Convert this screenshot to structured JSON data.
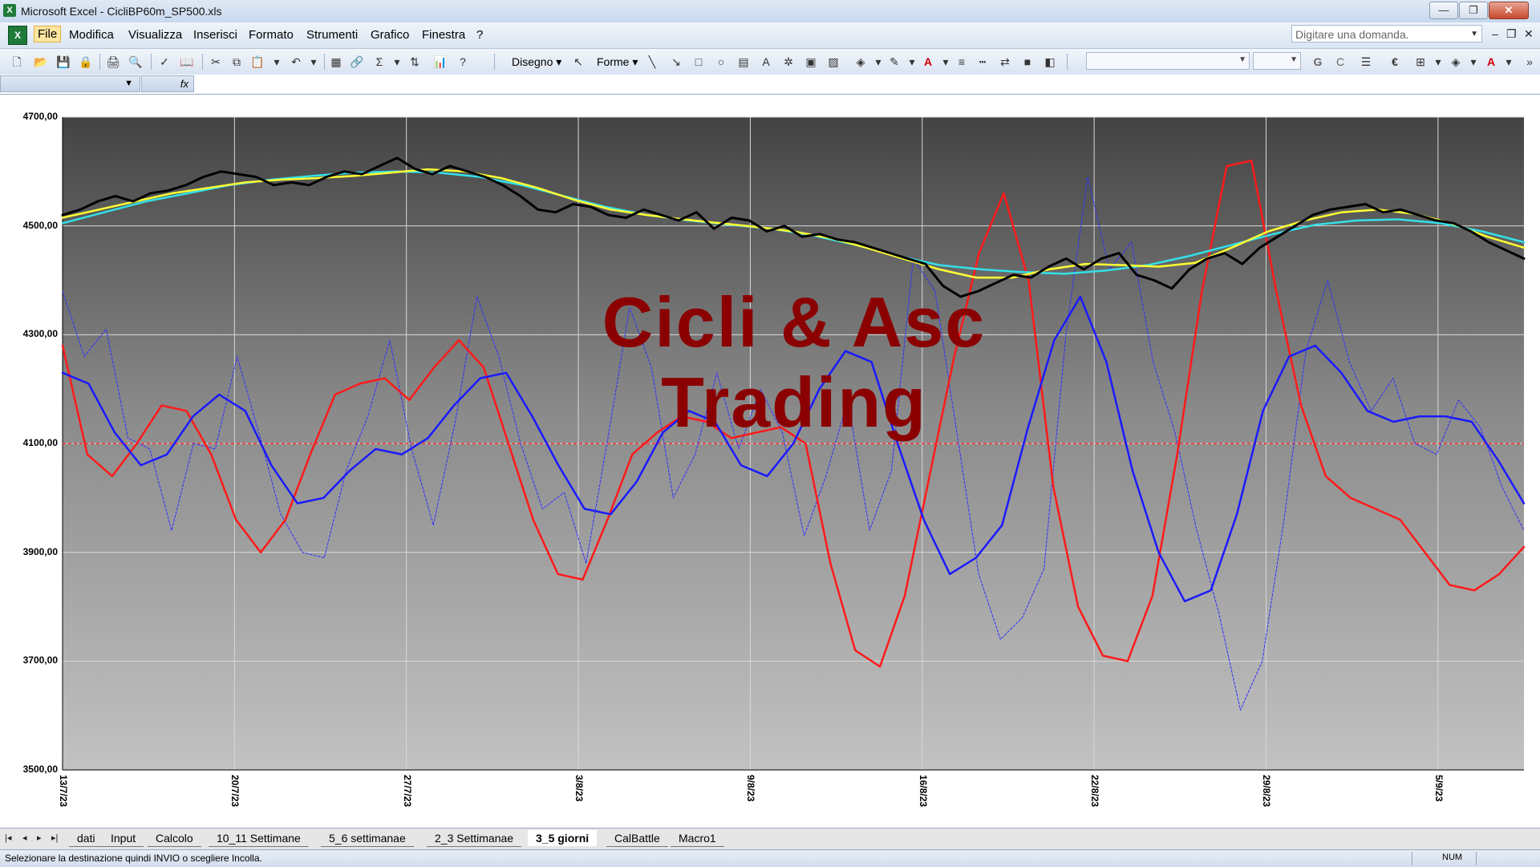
{
  "window": {
    "title": "Microsoft Excel - CicliBP60m_SP500.xls",
    "minimize": "—",
    "maximize": "❐",
    "close": "✕"
  },
  "menubar": {
    "items": [
      "File",
      "Modifica",
      "Visualizza",
      "Inserisci",
      "Formato",
      "Strumenti",
      "Grafico",
      "Finestra",
      "?"
    ],
    "active": "File",
    "ask_placeholder": "Digitare una domanda.",
    "mdi_min": "–",
    "mdi_restore": "❐",
    "mdi_close": "✕"
  },
  "toolbar": {
    "disegno_label": "Disegno ▾",
    "forme_label": "Forme ▾",
    "bold_label": "G",
    "italic_label": "C",
    "euro_label": "€"
  },
  "formula_bar": {
    "fx_label": "fx"
  },
  "chart_data": {
    "type": "line",
    "ylim": [
      3500,
      4700
    ],
    "yticks": [
      "4700,00",
      "4500,00",
      "4300,00",
      "4100,00",
      "3900,00",
      "3700,00",
      "3500,00"
    ],
    "xticks": [
      "13/7/23",
      "20/7/23",
      "27/7/23",
      "3/8/23",
      "9/8/23",
      "16/8/23",
      "22/8/23",
      "29/8/23",
      "5/9/23"
    ],
    "reference_line": 4100,
    "watermark": [
      "Cicli & Asc",
      "Trading"
    ],
    "colors": {
      "price": "#000000",
      "avg_yellow": "#ffff33",
      "avg_cyan": "#33e0e8",
      "cycle_red": "#ff1a1a",
      "cycle_blue": "#1a1aff",
      "cycle_blue_dotted": "#3030ff",
      "reference": "#ff3333"
    },
    "series": [
      {
        "key": "price",
        "values": [
          4520,
          4530,
          4545,
          4555,
          4545,
          4560,
          4565,
          4575,
          4590,
          4600,
          4595,
          4590,
          4575,
          4580,
          4575,
          4590,
          4600,
          4595,
          4610,
          4625,
          4605,
          4595,
          4610,
          4600,
          4590,
          4575,
          4555,
          4530,
          4525,
          4540,
          4535,
          4520,
          4515,
          4530,
          4520,
          4510,
          4525,
          4495,
          4515,
          4510,
          4490,
          4500,
          4480,
          4485,
          4475,
          4470,
          4460,
          4450,
          4440,
          4430,
          4390,
          4370,
          4380,
          4395,
          4410,
          4405,
          4425,
          4440,
          4420,
          4440,
          4450,
          4410,
          4400,
          4385,
          4420,
          4440,
          4450,
          4430,
          4460,
          4480,
          4500,
          4520,
          4530,
          4535,
          4540,
          4525,
          4530,
          4520,
          4510,
          4505,
          4490,
          4470,
          4455,
          4440
        ]
      },
      {
        "key": "avg_yellow",
        "values": [
          4515,
          4530,
          4545,
          4560,
          4570,
          4580,
          4585,
          4588,
          4592,
          4598,
          4604,
          4600,
          4588,
          4570,
          4548,
          4530,
          4520,
          4512,
          4505,
          4498,
          4490,
          4478,
          4460,
          4440,
          4420,
          4405,
          4405,
          4420,
          4430,
          4428,
          4425,
          4432,
          4460,
          4490,
          4510,
          4525,
          4530,
          4522,
          4505,
          4480,
          4460
        ]
      },
      {
        "key": "avg_cyan",
        "values": [
          4505,
          4525,
          4545,
          4560,
          4575,
          4585,
          4592,
          4598,
          4600,
          4598,
          4590,
          4575,
          4555,
          4535,
          4520,
          4510,
          4502,
          4495,
          4482,
          4465,
          4445,
          4428,
          4420,
          4415,
          4412,
          4418,
          4428,
          4445,
          4465,
          4485,
          4502,
          4510,
          4512,
          4505,
          4490,
          4470
        ]
      },
      {
        "key": "cycle_red",
        "values": [
          4280,
          4080,
          4040,
          4100,
          4170,
          4160,
          4080,
          3960,
          3900,
          3960,
          4080,
          4190,
          4210,
          4220,
          4180,
          4240,
          4290,
          4240,
          4100,
          3960,
          3860,
          3850,
          3960,
          4080,
          4120,
          4150,
          4140,
          4110,
          4120,
          4130,
          4100,
          3880,
          3720,
          3690,
          3820,
          4040,
          4260,
          4450,
          4560,
          4400,
          4020,
          3800,
          3710,
          3700,
          3820,
          4080,
          4380,
          4610,
          4620,
          4380,
          4170,
          4040,
          4000,
          3980,
          3960,
          3900,
          3840,
          3830,
          3860,
          3910
        ]
      },
      {
        "key": "cycle_blue",
        "values": [
          4230,
          4210,
          4120,
          4060,
          4080,
          4150,
          4190,
          4160,
          4060,
          3990,
          4000,
          4050,
          4090,
          4080,
          4110,
          4170,
          4220,
          4230,
          4150,
          4060,
          3980,
          3970,
          4030,
          4120,
          4160,
          4140,
          4060,
          4040,
          4100,
          4200,
          4270,
          4250,
          4100,
          3960,
          3860,
          3890,
          3950,
          4130,
          4290,
          4370,
          4250,
          4050,
          3900,
          3810,
          3830,
          3970,
          4160,
          4260,
          4280,
          4230,
          4160,
          4140,
          4150,
          4150,
          4140,
          4070,
          3990
        ]
      },
      {
        "key": "cycle_blue_dotted",
        "values": [
          4380,
          4260,
          4310,
          4110,
          4090,
          3940,
          4100,
          4090,
          4260,
          4120,
          3970,
          3900,
          3890,
          4050,
          4150,
          4290,
          4090,
          3950,
          4140,
          4370,
          4260,
          4100,
          3980,
          4010,
          3880,
          4110,
          4350,
          4240,
          4000,
          4080,
          4230,
          4090,
          4200,
          4120,
          3930,
          4040,
          4180,
          3940,
          4050,
          4440,
          4380,
          4120,
          3860,
          3740,
          3780,
          3870,
          4300,
          4590,
          4420,
          4470,
          4250,
          4120,
          3940,
          3790,
          3610,
          3700,
          3960,
          4270,
          4400,
          4250,
          4160,
          4220,
          4100,
          4080,
          4180,
          4130,
          4020,
          3940
        ]
      }
    ]
  },
  "sheet_tabs": {
    "nav": [
      "|◂",
      "◂",
      "▸",
      "▸|"
    ],
    "tabs": [
      "dati",
      "Input",
      "Calcolo",
      "10_11 Settimane",
      "5_6 settimanae",
      "2_3 Settimanae",
      "3_5 giorni",
      "CalBattle",
      "Macro1"
    ],
    "active": "3_5 giorni"
  },
  "status": {
    "message": "Selezionare la destinazione quindi INVIO o scegliere Incolla.",
    "num": "NUM"
  }
}
